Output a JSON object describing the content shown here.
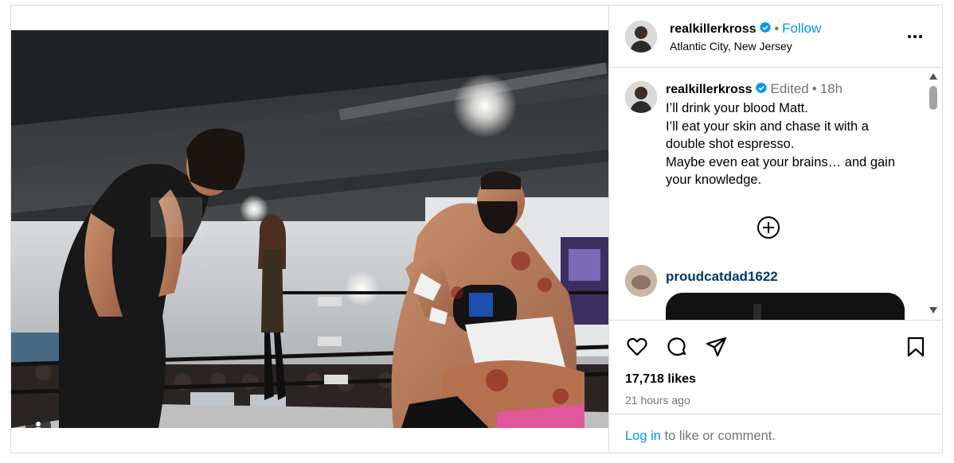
{
  "post": {
    "username": "realkillerkross",
    "follow_label": "Follow",
    "location": "Atlantic City, New Jersey",
    "more_icon": "more-options-icon"
  },
  "caption": {
    "username": "realkillerkross",
    "edited_label": "Edited",
    "time": "18h",
    "lines": [
      "I’ll drink your blood Matt.",
      "I’ll eat your skin and chase it with a",
      "double shot espresso.",
      "Maybe even eat your brains… and gain",
      "your knowledge."
    ]
  },
  "load_more_icon": "plus-circle-icon",
  "comment": {
    "username": "proudcatdad1622"
  },
  "actions": {
    "icons": [
      "heart-icon",
      "comment-icon",
      "share-icon",
      "bookmark-icon"
    ],
    "likes": "17,718 likes",
    "time_ago": "21 hours ago"
  },
  "login": {
    "link_label": "Log in",
    "rest_label": " to like or comment."
  },
  "colors": {
    "accent": "#0095f6",
    "verified": "#0095f6",
    "secondary_text": "#737373",
    "border": "#dbdbdb",
    "comment_username": "#00376b"
  }
}
